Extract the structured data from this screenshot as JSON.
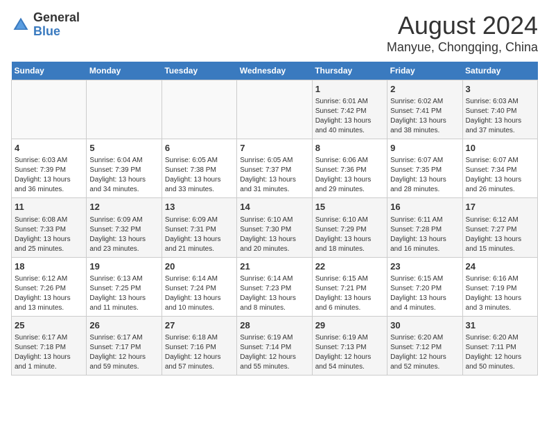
{
  "header": {
    "logo_general": "General",
    "logo_blue": "Blue",
    "main_title": "August 2024",
    "subtitle": "Manyue, Chongqing, China"
  },
  "days_of_week": [
    "Sunday",
    "Monday",
    "Tuesday",
    "Wednesday",
    "Thursday",
    "Friday",
    "Saturday"
  ],
  "weeks": [
    [
      {
        "day": "",
        "info": ""
      },
      {
        "day": "",
        "info": ""
      },
      {
        "day": "",
        "info": ""
      },
      {
        "day": "",
        "info": ""
      },
      {
        "day": "1",
        "info": "Sunrise: 6:01 AM\nSunset: 7:42 PM\nDaylight: 13 hours\nand 40 minutes."
      },
      {
        "day": "2",
        "info": "Sunrise: 6:02 AM\nSunset: 7:41 PM\nDaylight: 13 hours\nand 38 minutes."
      },
      {
        "day": "3",
        "info": "Sunrise: 6:03 AM\nSunset: 7:40 PM\nDaylight: 13 hours\nand 37 minutes."
      }
    ],
    [
      {
        "day": "4",
        "info": "Sunrise: 6:03 AM\nSunset: 7:39 PM\nDaylight: 13 hours\nand 36 minutes."
      },
      {
        "day": "5",
        "info": "Sunrise: 6:04 AM\nSunset: 7:39 PM\nDaylight: 13 hours\nand 34 minutes."
      },
      {
        "day": "6",
        "info": "Sunrise: 6:05 AM\nSunset: 7:38 PM\nDaylight: 13 hours\nand 33 minutes."
      },
      {
        "day": "7",
        "info": "Sunrise: 6:05 AM\nSunset: 7:37 PM\nDaylight: 13 hours\nand 31 minutes."
      },
      {
        "day": "8",
        "info": "Sunrise: 6:06 AM\nSunset: 7:36 PM\nDaylight: 13 hours\nand 29 minutes."
      },
      {
        "day": "9",
        "info": "Sunrise: 6:07 AM\nSunset: 7:35 PM\nDaylight: 13 hours\nand 28 minutes."
      },
      {
        "day": "10",
        "info": "Sunrise: 6:07 AM\nSunset: 7:34 PM\nDaylight: 13 hours\nand 26 minutes."
      }
    ],
    [
      {
        "day": "11",
        "info": "Sunrise: 6:08 AM\nSunset: 7:33 PM\nDaylight: 13 hours\nand 25 minutes."
      },
      {
        "day": "12",
        "info": "Sunrise: 6:09 AM\nSunset: 7:32 PM\nDaylight: 13 hours\nand 23 minutes."
      },
      {
        "day": "13",
        "info": "Sunrise: 6:09 AM\nSunset: 7:31 PM\nDaylight: 13 hours\nand 21 minutes."
      },
      {
        "day": "14",
        "info": "Sunrise: 6:10 AM\nSunset: 7:30 PM\nDaylight: 13 hours\nand 20 minutes."
      },
      {
        "day": "15",
        "info": "Sunrise: 6:10 AM\nSunset: 7:29 PM\nDaylight: 13 hours\nand 18 minutes."
      },
      {
        "day": "16",
        "info": "Sunrise: 6:11 AM\nSunset: 7:28 PM\nDaylight: 13 hours\nand 16 minutes."
      },
      {
        "day": "17",
        "info": "Sunrise: 6:12 AM\nSunset: 7:27 PM\nDaylight: 13 hours\nand 15 minutes."
      }
    ],
    [
      {
        "day": "18",
        "info": "Sunrise: 6:12 AM\nSunset: 7:26 PM\nDaylight: 13 hours\nand 13 minutes."
      },
      {
        "day": "19",
        "info": "Sunrise: 6:13 AM\nSunset: 7:25 PM\nDaylight: 13 hours\nand 11 minutes."
      },
      {
        "day": "20",
        "info": "Sunrise: 6:14 AM\nSunset: 7:24 PM\nDaylight: 13 hours\nand 10 minutes."
      },
      {
        "day": "21",
        "info": "Sunrise: 6:14 AM\nSunset: 7:23 PM\nDaylight: 13 hours\nand 8 minutes."
      },
      {
        "day": "22",
        "info": "Sunrise: 6:15 AM\nSunset: 7:21 PM\nDaylight: 13 hours\nand 6 minutes."
      },
      {
        "day": "23",
        "info": "Sunrise: 6:15 AM\nSunset: 7:20 PM\nDaylight: 13 hours\nand 4 minutes."
      },
      {
        "day": "24",
        "info": "Sunrise: 6:16 AM\nSunset: 7:19 PM\nDaylight: 13 hours\nand 3 minutes."
      }
    ],
    [
      {
        "day": "25",
        "info": "Sunrise: 6:17 AM\nSunset: 7:18 PM\nDaylight: 13 hours\nand 1 minute."
      },
      {
        "day": "26",
        "info": "Sunrise: 6:17 AM\nSunset: 7:17 PM\nDaylight: 12 hours\nand 59 minutes."
      },
      {
        "day": "27",
        "info": "Sunrise: 6:18 AM\nSunset: 7:16 PM\nDaylight: 12 hours\nand 57 minutes."
      },
      {
        "day": "28",
        "info": "Sunrise: 6:19 AM\nSunset: 7:14 PM\nDaylight: 12 hours\nand 55 minutes."
      },
      {
        "day": "29",
        "info": "Sunrise: 6:19 AM\nSunset: 7:13 PM\nDaylight: 12 hours\nand 54 minutes."
      },
      {
        "day": "30",
        "info": "Sunrise: 6:20 AM\nSunset: 7:12 PM\nDaylight: 12 hours\nand 52 minutes."
      },
      {
        "day": "31",
        "info": "Sunrise: 6:20 AM\nSunset: 7:11 PM\nDaylight: 12 hours\nand 50 minutes."
      }
    ]
  ]
}
